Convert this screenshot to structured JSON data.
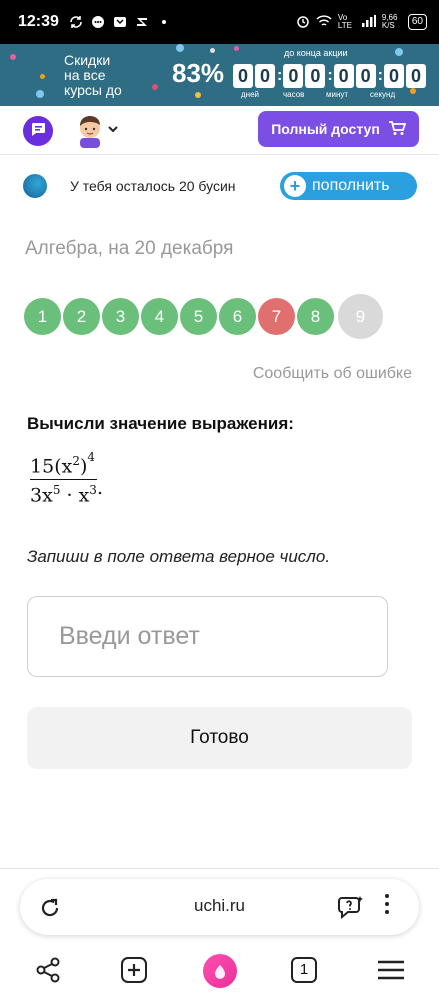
{
  "status_bar": {
    "time": "12:39",
    "network": "Vo LTE",
    "speed": "9,66 K/S",
    "battery": "60"
  },
  "promo": {
    "text_line1": "Скидки",
    "text_line2": "на все",
    "text_line3": "курсы до",
    "percent": "83%",
    "until_label": "до конца акции",
    "timer_digits": [
      "0",
      "0",
      "0",
      "0",
      "0",
      "0",
      "0",
      "0"
    ],
    "units": [
      "дней",
      "часов",
      "минут",
      "секунд"
    ]
  },
  "header": {
    "full_access_label": "Полный доступ"
  },
  "beads": {
    "text": "У тебя осталось 20 бусин",
    "topup_label": "пополнить"
  },
  "lesson": {
    "title": "Алгебра, на 20 декабря"
  },
  "questions": [
    "1",
    "2",
    "3",
    "4",
    "5",
    "6",
    "7",
    "8",
    "9"
  ],
  "report_link": "Сообщить об ошибке",
  "task": {
    "title": "Вычисли значение выражения:",
    "numerator": {
      "coef": "15",
      "base": "(x",
      "inner_exp": "2",
      "close": ")",
      "outer_exp": "4"
    },
    "denominator": {
      "coef": "3x",
      "exp1": "5",
      "mid": " · x",
      "exp2": "3"
    },
    "trailing": ".",
    "instruction": "Запиши в поле ответа верное число."
  },
  "answer": {
    "placeholder": "Введи ответ"
  },
  "done_label": "Готово",
  "browser": {
    "url": "uchi.ru",
    "tab_count": "1"
  },
  "colors": {
    "green": "#6abf7a",
    "red": "#e07070",
    "purple": "#7b4fe3",
    "blue": "#2aa0e0",
    "banner": "#2e6d83"
  }
}
